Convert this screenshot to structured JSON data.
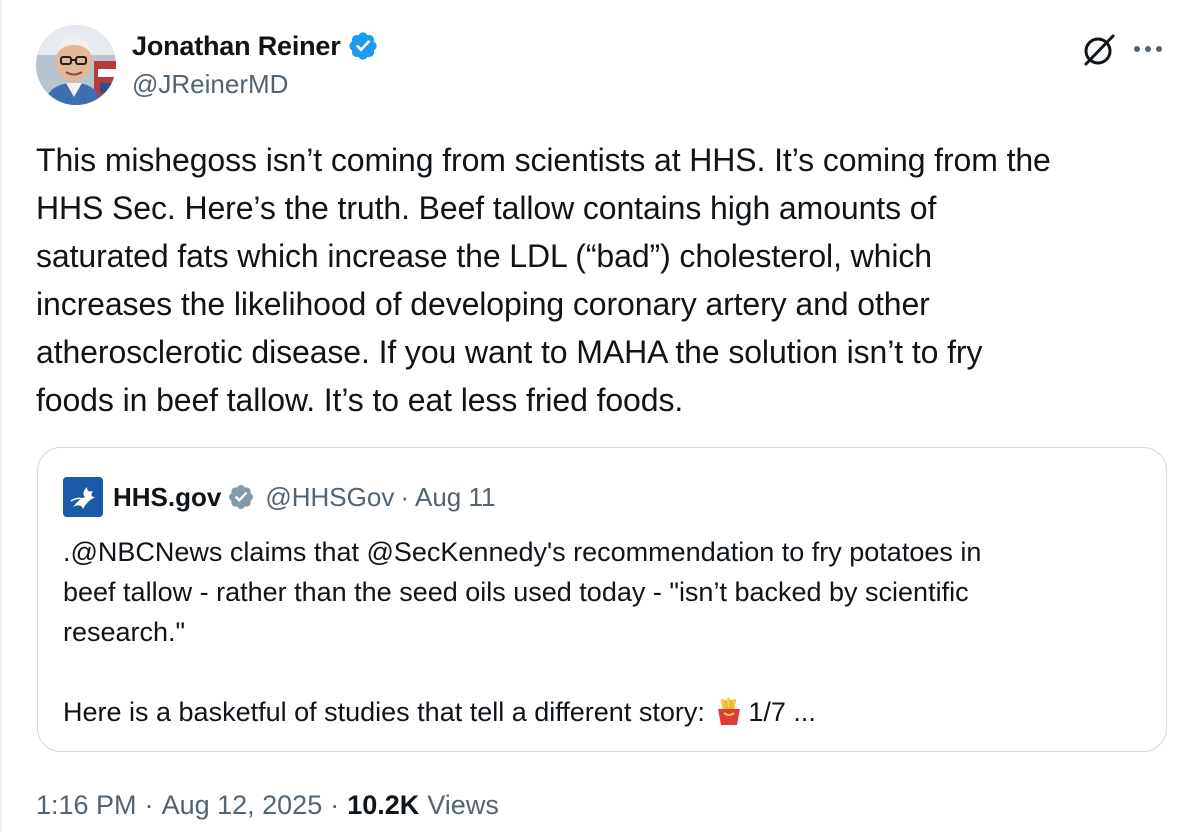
{
  "author": {
    "display_name": "Jonathan Reiner",
    "handle": "@JReinerMD"
  },
  "tweet": {
    "text": "This mishegoss isn’t coming from scientists at HHS. It’s coming from the\nHHS Sec. Here’s the truth. Beef tallow contains high amounts of\nsaturated fats which increase the LDL (“bad”) cholesterol, which\nincreases the likelihood of developing coronary artery and other\natherosclerotic disease. If you want to MAHA the solution isn’t to fry\nfoods in beef tallow. It’s to eat less fried foods."
  },
  "quoted": {
    "display_name": "HHS.gov",
    "handle": "@HHSGov",
    "separator": "·",
    "date": "Aug 11",
    "text": ".@NBCNews claims that @SecKennedy's recommendation to fry potatoes in\nbeef tallow - rather than the seed oils used today - \"isn’t backed by scientific\nresearch.\"\n\nHere is a basketful of studies that tell a different story: ",
    "text_suffix": "1/7 ..."
  },
  "footer": {
    "time": "1:16 PM",
    "sep1": "·",
    "date": "Aug 12, 2025",
    "sep2": "·",
    "views_count": "10.2K",
    "views_label": "Views"
  },
  "icons": {
    "verified": "verified-badge-icon",
    "grok": "grok-icon",
    "more": "more-options-icon",
    "fries": "french-fries-emoji"
  },
  "colors": {
    "verified_blue": "#1d9bf0",
    "gov_badge_gray": "#829aab",
    "secondary_text": "#536471",
    "border": "#cfd9de",
    "hhs_blue": "#1b5aa6"
  }
}
